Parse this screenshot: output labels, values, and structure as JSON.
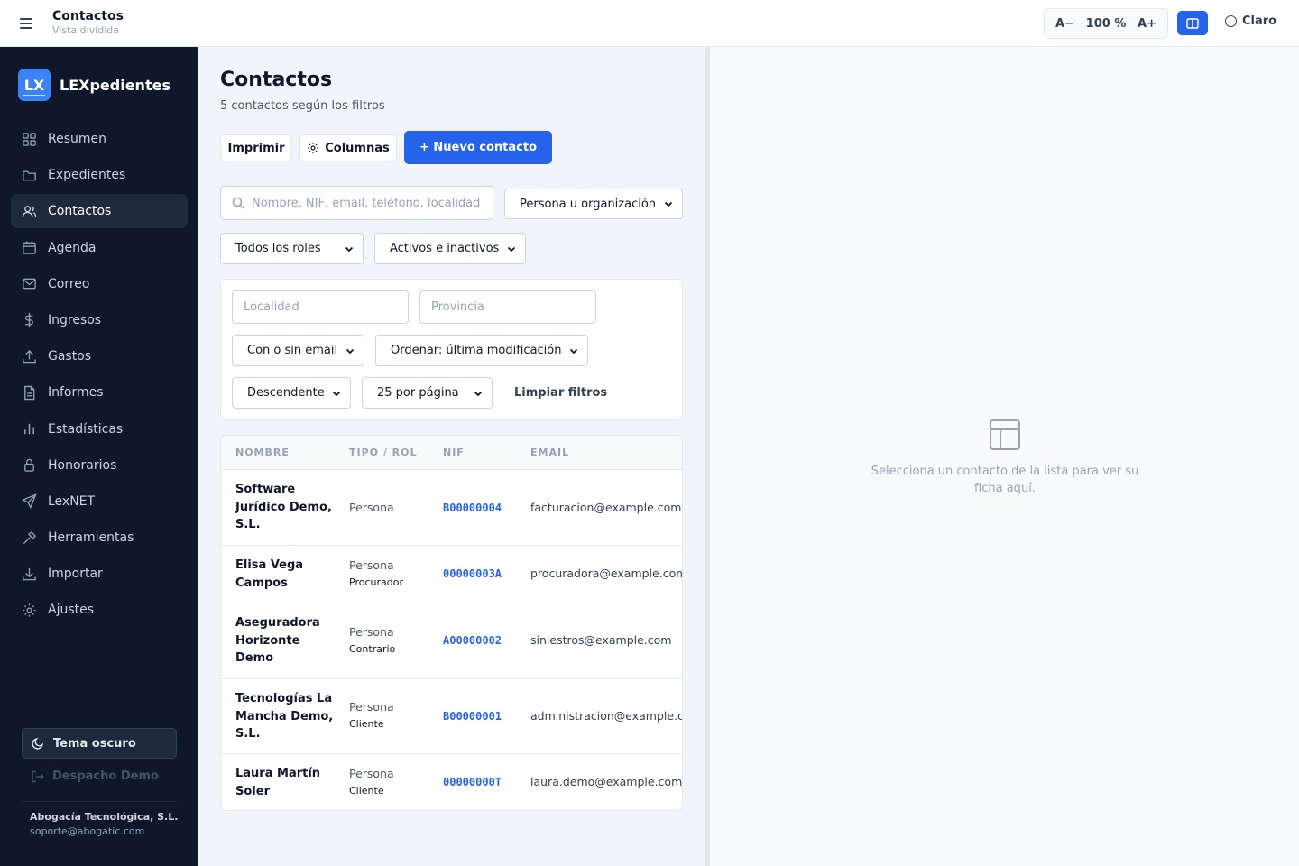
{
  "topbar": {
    "title": "Contactos",
    "subtitle": "Vista dividida",
    "zoom_out": "A−",
    "zoom_level": "100 %",
    "zoom_in": "A+",
    "theme_label": "Claro"
  },
  "sidebar": {
    "logo_text": "LX",
    "brand": "LEXpedientes",
    "items": [
      {
        "label": "Resumen",
        "icon": "grid-icon"
      },
      {
        "label": "Expedientes",
        "icon": "folder-icon"
      },
      {
        "label": "Contactos",
        "icon": "users-icon"
      },
      {
        "label": "Agenda",
        "icon": "calendar-icon"
      },
      {
        "label": "Correo",
        "icon": "mail-icon"
      },
      {
        "label": "Ingresos",
        "icon": "dollar-icon"
      },
      {
        "label": "Gastos",
        "icon": "upload-icon"
      },
      {
        "label": "Informes",
        "icon": "file-text-icon"
      },
      {
        "label": "Estadísticas",
        "icon": "bar-chart-icon"
      },
      {
        "label": "Honorarios",
        "icon": "lock-icon"
      },
      {
        "label": "LexNET",
        "icon": "send-icon"
      },
      {
        "label": "Herramientas",
        "icon": "hammer-icon"
      },
      {
        "label": "Importar",
        "icon": "download-icon"
      },
      {
        "label": "Ajustes",
        "icon": "gear-icon"
      }
    ],
    "active_index": 2,
    "dark_theme_label": "Tema oscuro",
    "logout_label": "Despacho Demo",
    "company_name": "Abogacía Tecnológica, S.L.",
    "company_email": "soporte@abogatic.com"
  },
  "main": {
    "title": "Contactos",
    "subtitle": "5 contactos según los filtros",
    "print_label": "Imprimir",
    "columns_label": "Columnas",
    "new_contact_label": "+ Nuevo contacto",
    "search_placeholder": "Nombre, NIF, email, teléfono, localidad",
    "type_filter": "Persona u organización",
    "role_filter": "Todos los roles",
    "status_filter": "Activos e inactivos",
    "locality_placeholder": "Localidad",
    "province_placeholder": "Provincia",
    "email_filter": "Con o sin email",
    "order_filter": "Ordenar: última modificación",
    "direction_filter": "Descendente",
    "page_size_filter": "25 por página",
    "clear_filters_label": "Limpiar filtros"
  },
  "table": {
    "headers": [
      "NOMBRE",
      "TIPO / ROL",
      "NIF",
      "EMAIL"
    ],
    "rows": [
      {
        "name": "Software Jurídico Demo, S.L.",
        "type": "Persona",
        "role": "",
        "nif": "B00000004",
        "email": "facturacion@example.com"
      },
      {
        "name": "Elisa Vega Campos",
        "type": "Persona",
        "role": "Procurador",
        "nif": "00000003A",
        "email": "procuradora@example.com"
      },
      {
        "name": "Aseguradora Horizonte Demo",
        "type": "Persona",
        "role": "Contrario",
        "nif": "A00000002",
        "email": "siniestros@example.com"
      },
      {
        "name": "Tecnologías La Mancha Demo, S.L.",
        "type": "Persona",
        "role": "Cliente",
        "nif": "B00000001",
        "email": "administracion@example.com"
      },
      {
        "name": "Laura Martín Soler",
        "type": "Persona",
        "role": "Cliente",
        "nif": "00000000T",
        "email": "laura.demo@example.com"
      }
    ]
  },
  "detail": {
    "empty_text": "Selecciona un contacto de la lista para ver su ficha aquí."
  },
  "colors": {
    "accent": "#2563eb",
    "sidebar_bg": "#0f172a",
    "sidebar_active": "#1e293b"
  }
}
